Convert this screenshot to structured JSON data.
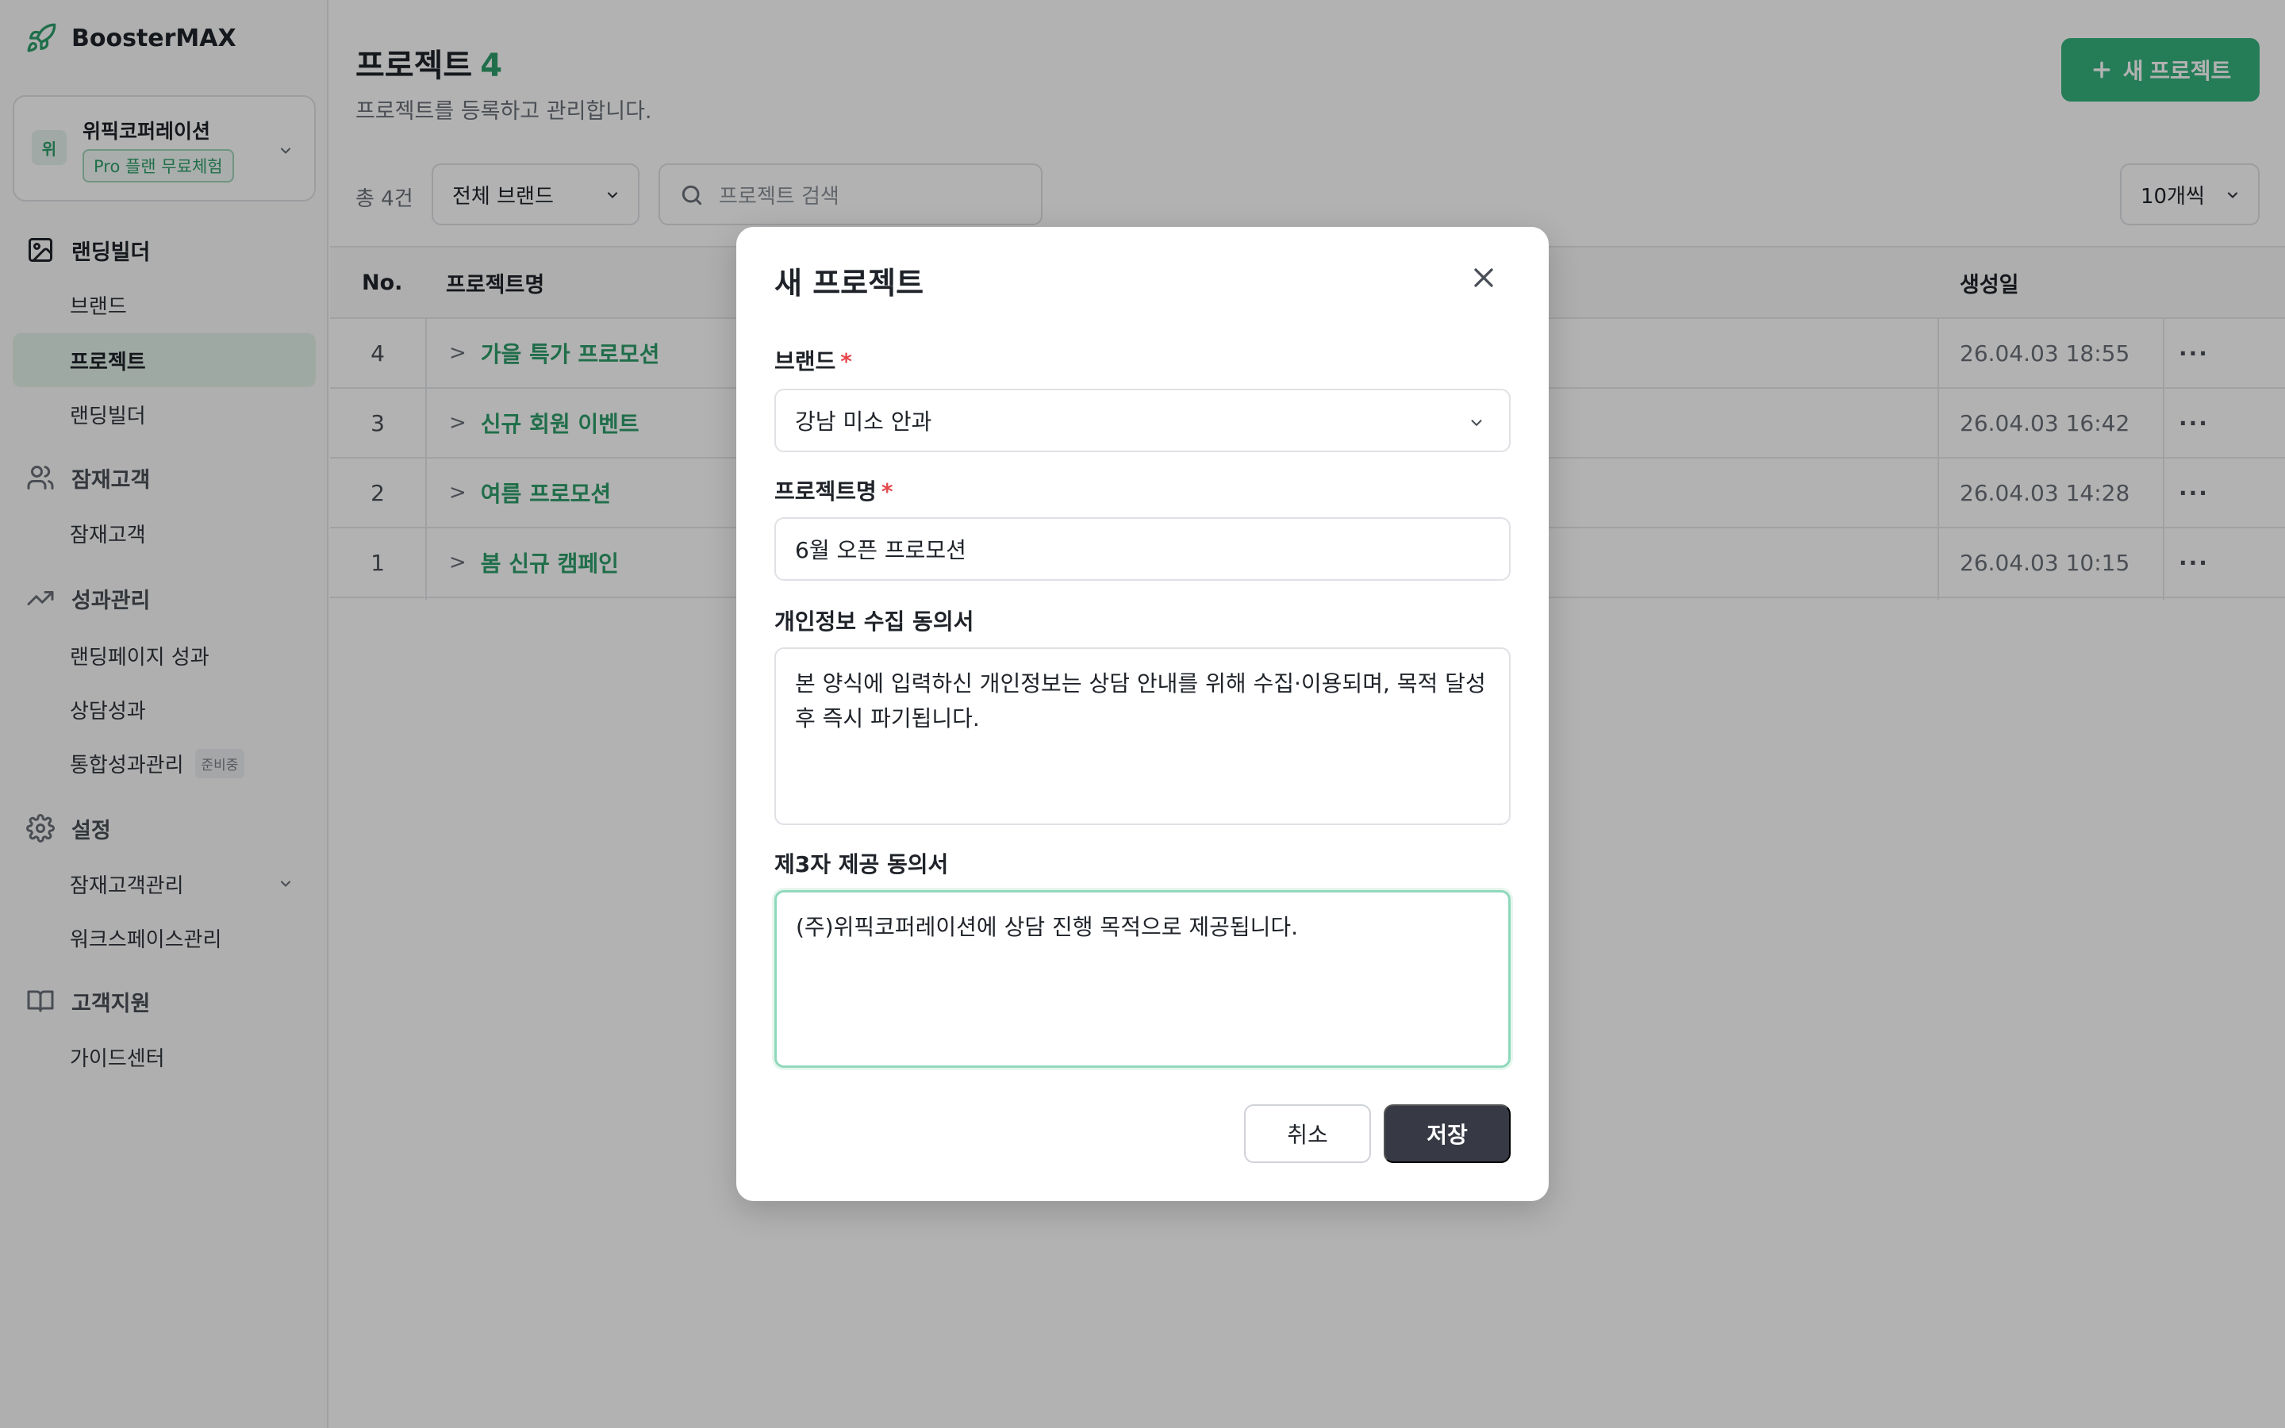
{
  "app": {
    "name": "BoosterMAX"
  },
  "workspace": {
    "avatar": "위",
    "name": "위픽코퍼레이션",
    "plan_badge": "Pro 플랜 무료체험"
  },
  "sidebar": {
    "sections": [
      {
        "label": "랜딩빌더",
        "icon": "image-icon",
        "items": [
          "브랜드",
          "프로젝트",
          "랜딩빌더"
        ]
      },
      {
        "label": "잠재고객",
        "icon": "users-icon",
        "items": [
          "잠재고객"
        ]
      },
      {
        "label": "성과관리",
        "icon": "trending-up-icon",
        "items": [
          "랜딩페이지 성과",
          "상담성과",
          "통합성과관리"
        ]
      },
      {
        "label": "설정",
        "icon": "gear-icon",
        "items": [
          "잠재고객관리",
          "워크스페이스관리"
        ]
      },
      {
        "label": "고객지원",
        "icon": "book-icon",
        "items": [
          "가이드센터"
        ]
      }
    ],
    "active_item": "프로젝트",
    "soon_badge": "준비중"
  },
  "page": {
    "title": "프로젝트",
    "count": "4",
    "subtitle": "프로젝트를 등록하고 관리합니다.",
    "new_button": "새 프로젝트"
  },
  "toolbar": {
    "total": "총 4건",
    "brand_filter": "전체 브랜드",
    "search_placeholder": "프로젝트 검색",
    "page_size": "10개씩"
  },
  "table": {
    "headers": {
      "no": "No.",
      "name": "프로젝트명",
      "created": "생성일"
    },
    "rows": [
      {
        "no": "4",
        "name": "가을 특가 프로모션",
        "created": "26.04.03 18:55"
      },
      {
        "no": "3",
        "name": "신규 회원 이벤트",
        "created": "26.04.03 16:42"
      },
      {
        "no": "2",
        "name": "여름 프로모션",
        "created": "26.04.03 14:28"
      },
      {
        "no": "1",
        "name": "봄 신규 캠페인",
        "created": "26.04.03 10:15"
      }
    ],
    "more_glyph": "···",
    "expand_glyph": ">"
  },
  "modal": {
    "title": "새 프로젝트",
    "brand_label": "브랜드",
    "brand_value": "강남 미소 안과",
    "name_label": "프로젝트명",
    "name_value": "6월 오픈 프로모션",
    "required_mark": "*",
    "privacy_label": "개인정보 수집 동의서",
    "privacy_value": "본 양식에 입력하신 개인정보는 상담 안내를 위해 수집·이용되며, 목적 달성 후 즉시 파기됩니다.",
    "third_party_label": "제3자 제공 동의서",
    "third_party_value": "(주)위픽코퍼레이션에 상담 진행 목적으로 제공됩니다.",
    "cancel": "취소",
    "save": "저장"
  },
  "colors": {
    "accent": "#2f9e6a",
    "primary_button": "#36b37e",
    "save_button": "#373a44"
  }
}
